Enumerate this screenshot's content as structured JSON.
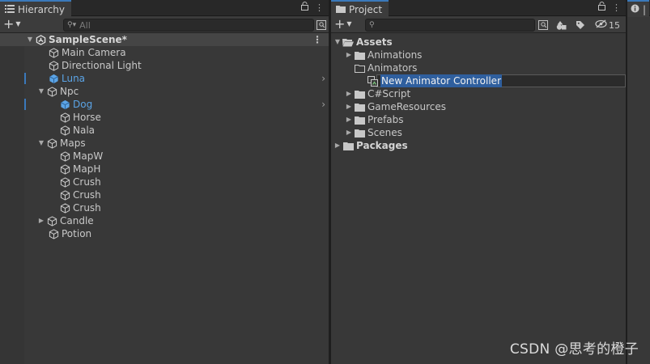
{
  "hierarchy": {
    "tab_label": "Hierarchy",
    "search_placeholder": "All",
    "scene_name": "SampleScene*",
    "items": [
      {
        "label": "Main Camera"
      },
      {
        "label": "Directional Light"
      },
      {
        "label": "Luna"
      },
      {
        "label": "Npc"
      },
      {
        "label": "Dog"
      },
      {
        "label": "Horse"
      },
      {
        "label": "Nala"
      },
      {
        "label": "Maps"
      },
      {
        "label": "MapW"
      },
      {
        "label": "MapH"
      },
      {
        "label": "Crush"
      },
      {
        "label": "Crush"
      },
      {
        "label": "Crush"
      },
      {
        "label": "Candle"
      },
      {
        "label": "Potion"
      }
    ]
  },
  "project": {
    "tab_label": "Project",
    "search_placeholder": "",
    "hidden_count": "15",
    "items": [
      {
        "label": "Assets"
      },
      {
        "label": "Animations"
      },
      {
        "label": "Animators"
      },
      {
        "label": "New Animator Controller"
      },
      {
        "label": "C#Script"
      },
      {
        "label": "GameResources"
      },
      {
        "label": "Prefabs"
      },
      {
        "label": "Scenes"
      },
      {
        "label": "Packages"
      }
    ]
  },
  "colors": {
    "panel_bg": "#383838",
    "selection_blue": "#2f5f9e",
    "accent_blue": "#3a79bb",
    "active_text_blue": "#5ba4e6"
  },
  "watermark": "CSDN @思考的橙子"
}
